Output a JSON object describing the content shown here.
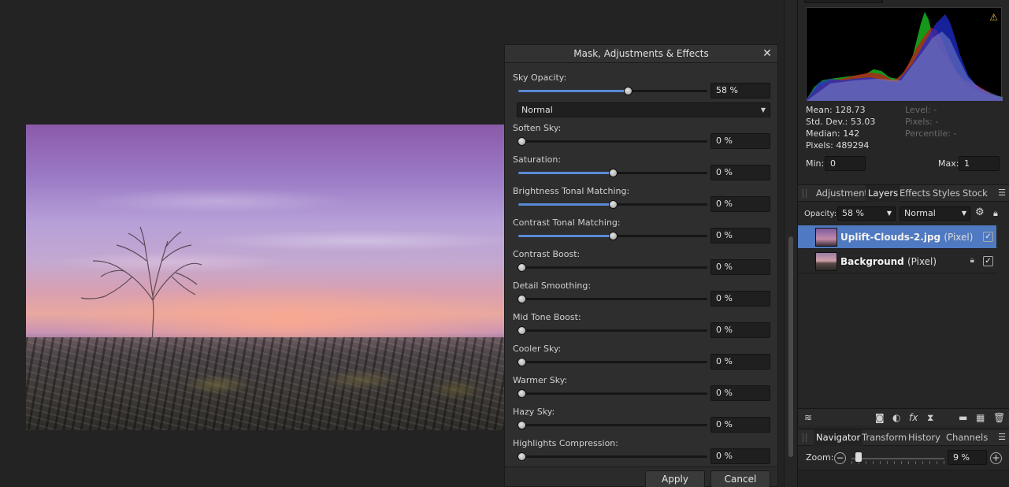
{
  "dialog": {
    "title": "Mask, Adjustments & Effects",
    "close_glyph": "✕",
    "sky_opacity": {
      "label": "Sky Opacity:",
      "value": "58 %",
      "level": 0.58
    },
    "blend_mode": "Normal",
    "sliders": [
      {
        "label": "Soften Sky:",
        "value": "0 %",
        "level": 0.0
      },
      {
        "label": "Saturation:",
        "value": "0 %",
        "level": 0.5
      },
      {
        "label": "Brightness Tonal Matching:",
        "value": "0 %",
        "level": 0.5
      },
      {
        "label": "Contrast Tonal Matching:",
        "value": "0 %",
        "level": 0.5
      },
      {
        "label": "Contrast Boost:",
        "value": "0 %",
        "level": 0.0
      },
      {
        "label": "Detail Smoothing:",
        "value": "0 %",
        "level": 0.0
      },
      {
        "label": "Mid Tone Boost:",
        "value": "0 %",
        "level": 0.0
      },
      {
        "label": "Cooler Sky:",
        "value": "0 %",
        "level": 0.0
      },
      {
        "label": "Warmer Sky:",
        "value": "0 %",
        "level": 0.0
      },
      {
        "label": "Hazy Sky:",
        "value": "0 %",
        "level": 0.0
      },
      {
        "label": "Highlights Compression:",
        "value": "0 %",
        "level": 0.0
      }
    ],
    "apply_label": "Apply",
    "cancel_label": "Cancel"
  },
  "histogram": {
    "mean": "Mean: 128.73",
    "std_dev": "Std. Dev.: 53.03",
    "median": "Median: 142",
    "pixels": "Pixels: 489294",
    "level": "Level: -",
    "pixels_sel": "Pixels: -",
    "percentile": "Percentile: -",
    "min_label": "Min:",
    "min_value": "0",
    "max_label": "Max:",
    "max_value": "1",
    "warning_icon": "warning-icon"
  },
  "panel_tabs": [
    "Adjustment",
    "Layers",
    "Effects",
    "Styles",
    "Stock"
  ],
  "layers_panel": {
    "opacity_label": "Opacity:",
    "opacity_value": "58 %",
    "blend_mode": "Normal",
    "layers": [
      {
        "name": "Uplift-Clouds-2.jpg",
        "type": "(Pixel)",
        "selected": true,
        "checked": "✓"
      },
      {
        "name": "Background",
        "type": "(Pixel)",
        "selected": false,
        "checked": "✓"
      }
    ]
  },
  "nav_tabs": [
    "Navigator",
    "Transform",
    "History",
    "Channels"
  ],
  "navigator": {
    "zoom_label": "Zoom:",
    "zoom_value": "9 %",
    "zoom_level": 0.05
  },
  "colors": {
    "accent": "#5a8ad6",
    "selection": "#4f79c0",
    "warning": "#f2c230"
  }
}
